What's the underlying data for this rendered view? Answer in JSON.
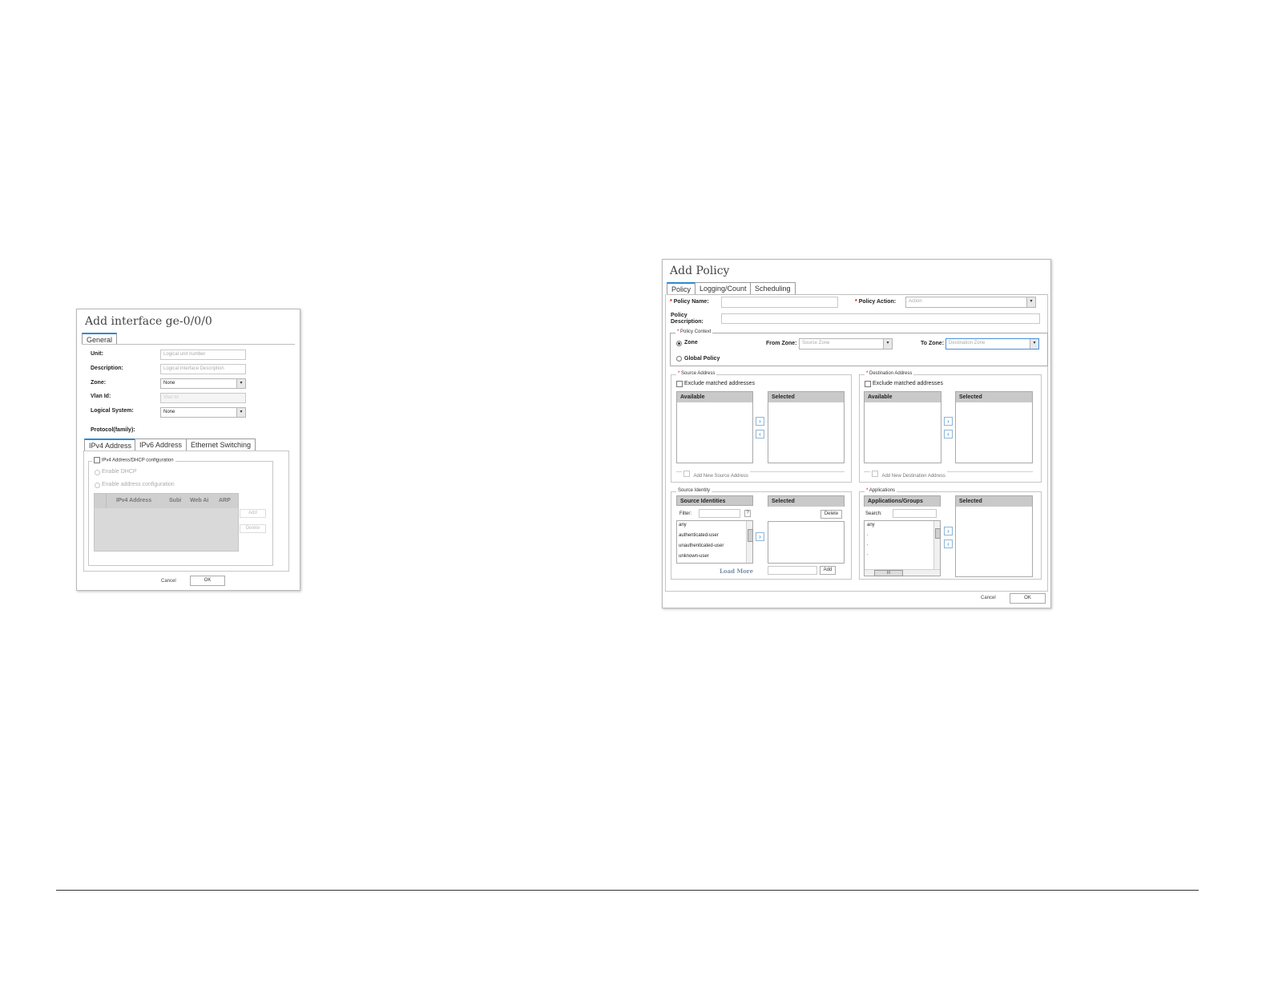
{
  "interface_dialog": {
    "title": "Add interface ge-0/0/0",
    "tabs": [
      "General"
    ],
    "labels": {
      "unit": "Unit:",
      "description": "Description:",
      "zone": "Zone:",
      "vlan_id": "Vlan Id:",
      "logical_system": "Logical System:",
      "protocol_family": "Protocol(family):"
    },
    "placeholders": {
      "unit": "Logical unit number",
      "description": "Logical Interface Description",
      "vlan_id": "Vlan Id"
    },
    "zone_value": "None",
    "logical_system_value": "None",
    "protocol_tabs": [
      "IPv4 Address",
      "IPv6 Address",
      "Ethernet Switching"
    ],
    "ipv4_config_label": "IPv4 Address/DHCP configuration",
    "enable_dhcp": "Enable DHCP",
    "enable_address_config": "Enable address configuration",
    "table_columns": [
      "IPv4 Address",
      "Subi",
      "Web Ai",
      "ARP"
    ],
    "add_button": "Add",
    "delete_button": "Delete",
    "cancel": "Cancel",
    "ok": "OK"
  },
  "policy_dialog": {
    "title": "Add Policy",
    "tabs": [
      "Policy",
      "Logging/Count",
      "Scheduling"
    ],
    "required_mark": "*",
    "policy_name_label": "Policy Name:",
    "policy_action_label": "Policy Action:",
    "policy_action_placeholder": "Action",
    "policy_description_label_1": "Policy",
    "policy_description_label_2": "Description:",
    "policy_context_legend": "Policy Context",
    "zone_label": "Zone",
    "global_policy_label": "Global Policy",
    "from_zone_label": "From Zone:",
    "from_zone_placeholder": "Source Zone",
    "to_zone_label": "To Zone:",
    "to_zone_placeholder": "Destination Zone",
    "source_address": {
      "legend": "Source Address",
      "exclude_label": "Exclude matched addresses",
      "available": "Available",
      "selected": "Selected",
      "add_new": "Add New Source Address"
    },
    "destination_address": {
      "legend": "Destination Address",
      "exclude_label": "Exclude matched addresses",
      "available": "Available",
      "selected": "Selected",
      "add_new": "Add New Destination Address"
    },
    "source_identity": {
      "legend": "Source Identity",
      "list_header": "Source Identities",
      "selected": "Selected",
      "filter_label": "Filter:",
      "filter_help": "?",
      "items": [
        "any",
        "authenticated-user",
        "unauthenticated-user",
        "unknown-user"
      ],
      "load_more": "Load More",
      "delete_button": "Delete",
      "add_button": "Add"
    },
    "applications": {
      "legend": "Applications",
      "list_header": "Applications/Groups",
      "selected": "Selected",
      "search_label": "Search:",
      "items": [
        "any",
        ".",
        ".",
        "."
      ],
      "scroll_mid": "III"
    },
    "cancel": "Cancel",
    "ok": "OK"
  },
  "icons": {
    "right_arrow": "›",
    "left_arrow": "‹",
    "dropdown": "▾"
  }
}
